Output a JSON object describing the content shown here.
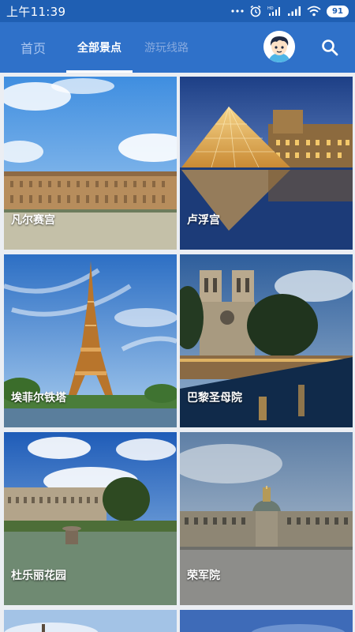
{
  "status_bar": {
    "time": "上午11:39",
    "icons": [
      "dots-icon",
      "alarm-icon",
      "signal-hd-icon",
      "signal-icon",
      "wifi-icon",
      "battery-icon"
    ],
    "battery_level": "91"
  },
  "header": {
    "tabs": [
      {
        "label": "首页",
        "selected": false
      },
      {
        "label": "全部景点",
        "selected": true
      },
      {
        "label": "游玩线路",
        "selected": false
      }
    ],
    "accent_color": "#2f71c9",
    "status_bar_color": "#1f5fb3"
  },
  "attractions": [
    {
      "name": "凡尔赛宫"
    },
    {
      "name": "卢浮宫"
    },
    {
      "name": "埃菲尔铁塔"
    },
    {
      "name": "巴黎圣母院"
    },
    {
      "name": "杜乐丽花园"
    },
    {
      "name": "荣军院"
    }
  ]
}
